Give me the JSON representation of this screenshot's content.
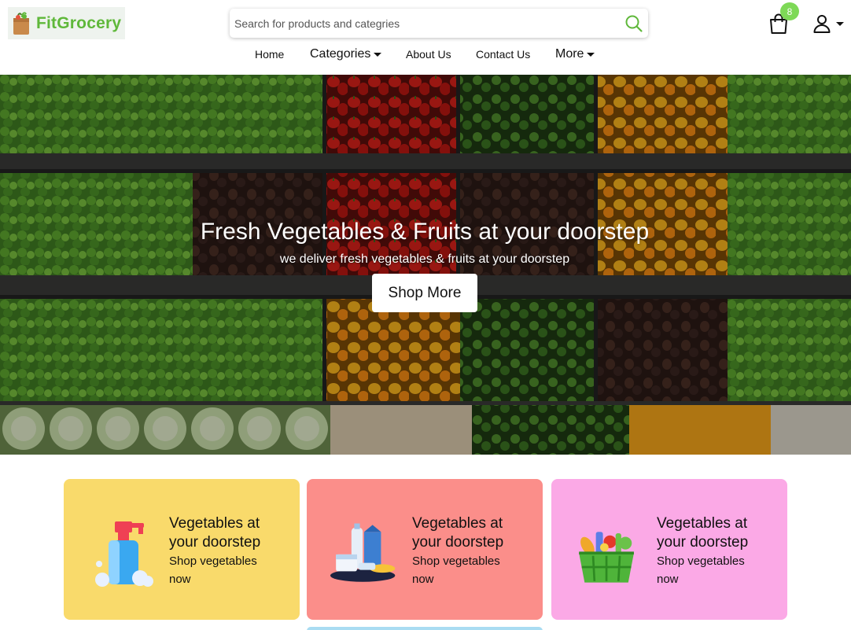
{
  "brand": {
    "name": "FitGrocery"
  },
  "search": {
    "placeholder": "Search for products and categries"
  },
  "cart": {
    "count": "8"
  },
  "nav": {
    "home": "Home",
    "categories": "Categories",
    "about": "About Us",
    "contact": "Contact Us",
    "more": "More"
  },
  "hero": {
    "title": "Fresh Vegetables & Fruits at your doorstep",
    "subtitle": "we deliver fresh vegetables & fruits at your doorstep",
    "button": "Shop More"
  },
  "cards": [
    {
      "title": "Vegetables at your doorstep",
      "desc": "Shop vegetables now",
      "color": "#f9da6b",
      "icon": "soap-bottle-icon"
    },
    {
      "title": "Vegetables at your doorstep",
      "desc": "Shop vegetables now",
      "color": "#fb8e8a",
      "icon": "dairy-products-icon"
    },
    {
      "title": "Vegetables at your doorstep",
      "desc": "Shop vegetables now",
      "color": "#fba9e6",
      "icon": "grocery-basket-icon"
    }
  ],
  "colors": {
    "accent": "#5fb83a",
    "badge": "#7ed957"
  }
}
